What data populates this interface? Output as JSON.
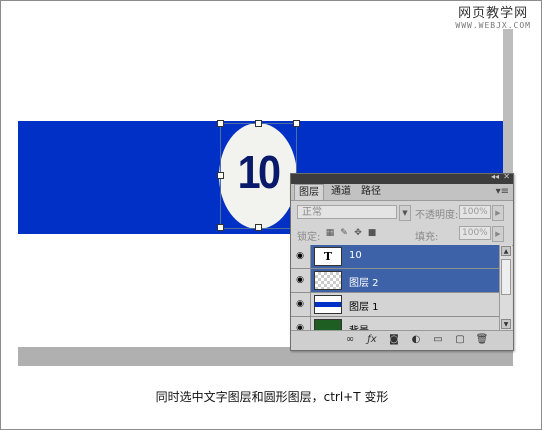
{
  "watermark": {
    "title": "网页教学网",
    "url": "WWW.WEBJX.COM"
  },
  "canvas": {
    "oval_text": "10",
    "band_color": "#0030c6"
  },
  "panel": {
    "tabs": [
      "图层",
      "通道",
      "路径"
    ],
    "blend_mode": "正常",
    "opacity_label": "不透明度:",
    "opacity_value": "100%",
    "lock_label": "锁定:",
    "fill_label": "填充:",
    "fill_value": "100%",
    "layers": [
      {
        "name": "10",
        "thumb": "T",
        "selected": true
      },
      {
        "name": "图层 2",
        "selected": true
      },
      {
        "name": "图层 1",
        "selected": false
      },
      {
        "name": "背景",
        "selected": false
      }
    ]
  },
  "caption": "同时选中文字图层和圆形图层，ctrl+T 变形"
}
